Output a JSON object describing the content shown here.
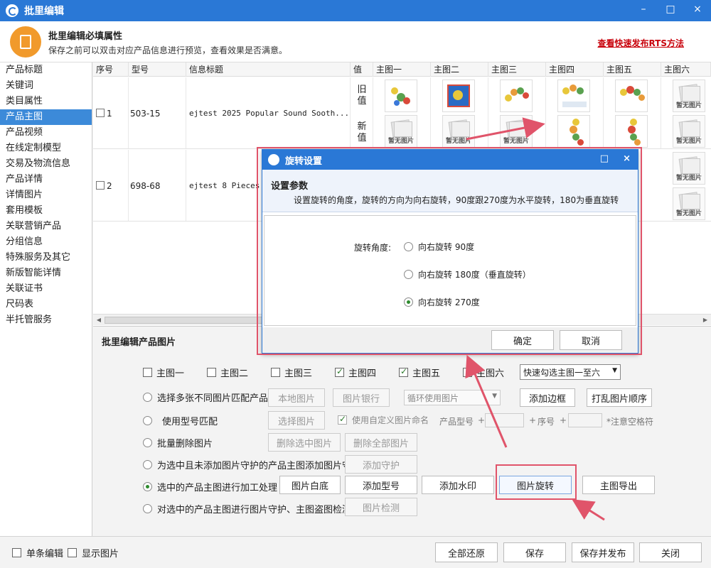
{
  "window": {
    "title": "批里编辑",
    "min": "–",
    "max": "□",
    "close": "×"
  },
  "header": {
    "title": "批里编辑必填属性",
    "subtitle": "保存之前可以双击对应产品信息进行预览，查看效果是否满意。",
    "link": "查看快速发布RTS方法"
  },
  "sidebar": {
    "items": [
      "产品标题",
      "关键词",
      "类目属性",
      "产品主图",
      "产品视频",
      "在线定制模型",
      "交易及物流信息",
      "产品详情",
      "详情图片",
      "套用模板",
      "关联营销产品",
      "分组信息",
      "特殊服务及其它",
      "新版智能详情",
      "关联证书",
      "尺码表",
      "半托管服务"
    ],
    "active_index": 3
  },
  "table": {
    "headers": [
      "序号",
      "型号",
      "信息标题",
      "值",
      "主图一",
      "主图二",
      "主图三",
      "主图四",
      "主图五",
      "主图六"
    ],
    "rows": [
      {
        "index": "1",
        "model": "503-15",
        "title": "ejtest 2025 Popular Sound Sooth...",
        "old_label": "旧值",
        "new_label": "新值"
      },
      {
        "index": "2",
        "model": "698-68",
        "title": "ejtest 8 Pieces G"
      }
    ],
    "no_image_text": "暂无图片"
  },
  "panel": {
    "title": "批里编辑产品图片",
    "image_checks": [
      {
        "label": "主图一",
        "checked": false
      },
      {
        "label": "主图二",
        "checked": false
      },
      {
        "label": "主图三",
        "checked": false
      },
      {
        "label": "主图四",
        "checked": true
      },
      {
        "label": "主图五",
        "checked": true
      },
      {
        "label": "主图六",
        "checked": false
      }
    ],
    "quick_select": "快速勾选主图一至六",
    "options": {
      "multi": "选择多张不同图片匹配产品",
      "model": "使用型号匹配",
      "delete": "批量删除图片",
      "guard": "为选中且未添加图片守护的产品主图添加图片守护",
      "process": "选中的产品主图进行加工处理",
      "detect": "对选中的产品主图进行图片守护、主图盗图检测"
    },
    "buttons": {
      "local": "本地图片",
      "bank": "图片银行",
      "cycle": "循环使用图片",
      "border": "添加边框",
      "shuffle": "打乱图片顺序",
      "choose": "选择图片",
      "custom_name": "使用自定义图片命名",
      "prod_model": "产品型号",
      "plus": "+",
      "seq": "序号",
      "space_note": "*注意空格符",
      "del_sel": "删除选中图片",
      "del_all": "删除全部图片",
      "add_guard": "添加守护",
      "white": "图片白底",
      "add_model": "添加型号",
      "watermark": "添加水印",
      "rotate": "图片旋转",
      "export": "主图导出",
      "detect": "图片检测"
    }
  },
  "footer": {
    "single_edit": "单条编辑",
    "show_images": "显示图片",
    "restore": "全部还原",
    "save": "保存",
    "save_publish": "保存并发布",
    "close": "关闭"
  },
  "dialog": {
    "title": "旋转设置",
    "section": "设置参数",
    "desc": "设置旋转的角度，旋转的方向为向右旋转，90度跟270度为水平旋转，180为垂直旋转",
    "angle_label": "旋转角度:",
    "options": [
      "向右旋转 90度",
      "向右旋转 180度（垂直旋转）",
      "向右旋转 270度"
    ],
    "selected": 2,
    "ok": "确定",
    "cancel": "取消",
    "max": "□",
    "close": "×"
  },
  "colors": {
    "accent": "#2a78d6",
    "active": "#3c8ad9",
    "highlight": "#e0546a",
    "link": "#c8000a"
  }
}
